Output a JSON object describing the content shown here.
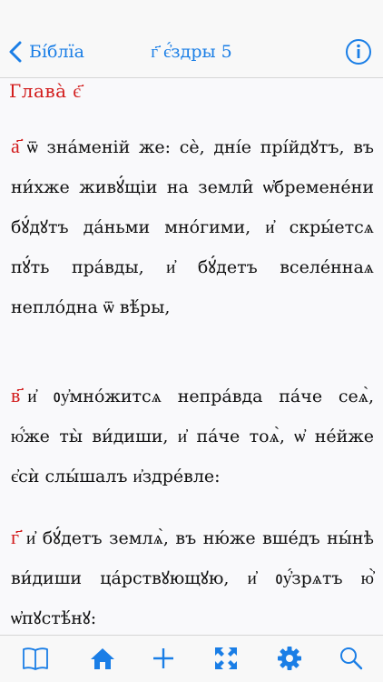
{
  "nav": {
    "back_label": "Бі́блїа",
    "title": "г҃ є҆́здры 5",
    "back_icon": "chevron-left-icon",
    "info_icon": "info-icon"
  },
  "chapter": {
    "heading": "Глава̀ є҃"
  },
  "verses": [
    {
      "number": "а҃",
      "text": "ѿ зна́меній же: сѐ, дні́е прі́йдꙋтъ, въ ни́хже живꙋ́щіи на земли̑ ѡ҆бремене́ни бꙋ́дꙋтъ да́ньми мно́гими, и҆ скры́етсѧ пꙋ́ть пра́вды, и҆ бꙋ́детъ вселе́ннаѧ непло́дна ѿ вѣ́ры,"
    },
    {
      "number": "в҃",
      "text": "и҆ ᲂу҆мно́житсѧ непра́вда па́че сеѧ̀, ю҆́же ты̀ ви́диши, и҆ па́че тоѧ̀, ѡ҆ не́йже є҆сѝ слы́шалъ и҆здре́вле:"
    },
    {
      "number": "г҃",
      "text": "и҆ бꙋ́детъ землѧ̀, въ ню́же вше́дъ ны́нѣ ви́диши ца́рствꙋющꙋю, и҆ ᲂу҆́зрѧтъ ю҆̀ ѡ҆пꙋстѣ́нꙋ:"
    }
  ],
  "toolbar": {
    "items": [
      "book-icon",
      "home-icon",
      "add-icon",
      "fullscreen-icon",
      "gear-icon",
      "search-icon"
    ]
  },
  "colors": {
    "accent": "#1a7ee6",
    "rubric": "#d21b1b",
    "text": "#111111",
    "background": "#f9f9fb"
  }
}
